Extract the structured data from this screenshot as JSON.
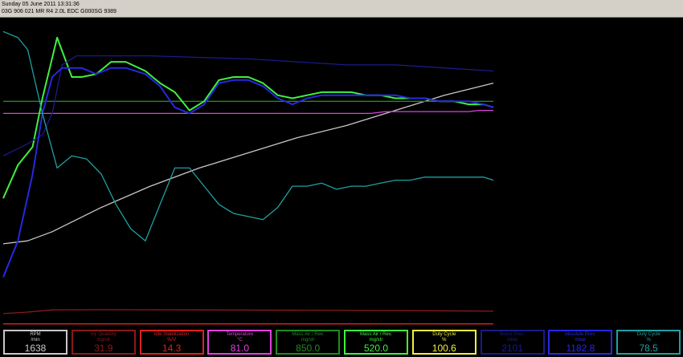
{
  "header": {
    "date_line": "Sunday 05 June 2011 13:31:36",
    "ecu_line": "03G 906 021 MR  R4 2.0L EDC G000SG  9389"
  },
  "panels": [
    {
      "name": "RPM",
      "unit": "/min",
      "value": "1638",
      "color": "#c8c8c8",
      "border": "#c8c8c8",
      "text_color": "#c8c8c8"
    },
    {
      "name": "Inj. Quantity",
      "unit": "mg/str",
      "value": "31.9",
      "color": "#8b1a1a",
      "border": "#8b1a1a",
      "text_color": "#8b1a1a"
    },
    {
      "name": "Idle Stabilization",
      "unit": "%/V",
      "value": "14.3",
      "color": "#e02020",
      "border": "#e02020",
      "text_color": "#e02020"
    },
    {
      "name": "Temperature",
      "unit": "°C",
      "value": "81.0",
      "color": "#e040e0",
      "border": "#e040e0",
      "text_color": "#e040e0"
    },
    {
      "name": "Mass Air / Rev.",
      "unit": "mg/str",
      "value": "850.0",
      "color": "#1e8c1e",
      "border": "#1e8c1e",
      "text_color": "#1e8c1e"
    },
    {
      "name": "Mass Air / Rev.",
      "unit": "mg/str",
      "value": "520.0",
      "color": "#40f040",
      "border": "#40f040",
      "text_color": "#40f040"
    },
    {
      "name": "Duty Cycle",
      "unit": "%",
      "value": "100.6",
      "color": "#f0f040",
      "border": "#f0f040",
      "text_color": "#f0f040"
    },
    {
      "name": "Boost Pres.",
      "unit": "mbar",
      "value": "2101",
      "color": "#1a1a8b",
      "border": "#1a1a8b",
      "text_color": "#1a1a8b"
    },
    {
      "name": "Absolute Pres.",
      "unit": "mbar",
      "value": "1182.8",
      "color": "#2828e0",
      "border": "#2828e0",
      "text_color": "#2828e0"
    },
    {
      "name": "Duty Cycle",
      "unit": "%",
      "value": "78.5",
      "color": "#20a0a0",
      "border": "#20a0a0",
      "text_color": "#20a0a0"
    }
  ],
  "chart_data": {
    "type": "line",
    "grid": false,
    "x_range": [
      0,
      100
    ],
    "y_range": [
      0,
      100
    ],
    "series": [
      {
        "name": "RPM",
        "color": "#c8c8c8",
        "x": [
          0,
          5,
          10,
          20,
          30,
          40,
          50,
          60,
          70,
          80,
          90,
          100
        ],
        "y": [
          27,
          28,
          31,
          39,
          46,
          52,
          57,
          62,
          66,
          71,
          76,
          80
        ]
      },
      {
        "name": "Inj. Quantity",
        "color": "#8b1a1a",
        "x": [
          0,
          5,
          10,
          20,
          40,
          60,
          80,
          100
        ],
        "y": [
          4,
          4.5,
          5.2,
          5.3,
          5.2,
          5.1,
          5.0,
          4.8
        ]
      },
      {
        "name": "Idle Stabilization",
        "color": "#e02020",
        "x": [
          0,
          100
        ],
        "y": [
          0.6,
          0.6
        ]
      },
      {
        "name": "Temperature",
        "color": "#e040e0",
        "x": [
          0,
          50,
          75,
          78,
          95,
          97,
          100
        ],
        "y": [
          70,
          70,
          70,
          70.6,
          70.6,
          71,
          71
        ]
      },
      {
        "name": "Mass Air / Rev.",
        "color": "#1e8c1e",
        "x": [
          0,
          100
        ],
        "y": [
          74,
          74
        ]
      },
      {
        "name": "Mass Air / Rev.",
        "color": "#40f040",
        "x": [
          0,
          3,
          6,
          8,
          11,
          14,
          16,
          19,
          22,
          25,
          29,
          32,
          35,
          38,
          41,
          44,
          47,
          50,
          53,
          56,
          59,
          62,
          65,
          68,
          71,
          74,
          77,
          80,
          83,
          86,
          89,
          92,
          95,
          98,
          100
        ],
        "y": [
          42,
          53,
          59,
          75,
          95,
          82,
          82,
          83,
          87,
          87,
          84,
          80,
          77,
          71,
          74,
          81,
          82,
          82,
          80,
          76,
          75,
          76,
          77,
          77,
          77,
          76,
          76,
          75,
          75,
          75,
          74,
          74,
          73,
          73,
          72
        ]
      },
      {
        "name": "Boost Pres.",
        "color": "#1a1a8b",
        "x": [
          0,
          5,
          8,
          10,
          12,
          15,
          30,
          50,
          60,
          70,
          80,
          90,
          100
        ],
        "y": [
          56,
          60,
          63,
          70,
          86,
          89,
          89,
          88,
          87,
          86,
          86,
          85,
          84
        ]
      },
      {
        "name": "Absolute Pres.",
        "color": "#2828e0",
        "x": [
          0,
          3,
          6,
          8,
          10,
          12,
          16,
          19,
          22,
          25,
          29,
          32,
          35,
          38,
          41,
          44,
          47,
          50,
          53,
          56,
          59,
          62,
          65,
          68,
          71,
          74,
          77,
          80,
          83,
          86,
          89,
          92,
          95,
          98,
          100
        ],
        "y": [
          16,
          28,
          50,
          70,
          82,
          85,
          85,
          83,
          85,
          85,
          83,
          79,
          72,
          70,
          73,
          80,
          81,
          81,
          79,
          75,
          73,
          75,
          76,
          76,
          76,
          76,
          76,
          76,
          75,
          75,
          74,
          74,
          74,
          73,
          72
        ]
      },
      {
        "name": "Duty Cycle",
        "color": "#20a0a0",
        "x": [
          0,
          3,
          5,
          8,
          11,
          14,
          17,
          20,
          23,
          26,
          29,
          32,
          35,
          38,
          41,
          44,
          47,
          50,
          53,
          56,
          59,
          62,
          65,
          68,
          71,
          74,
          77,
          80,
          83,
          86,
          89,
          92,
          95,
          98,
          100
        ],
        "y": [
          97,
          95,
          91,
          70,
          52,
          56,
          55,
          50,
          40,
          32,
          28,
          40,
          52,
          52,
          46,
          40,
          37,
          36,
          35,
          39,
          46,
          46,
          47,
          45,
          46,
          46,
          47,
          48,
          48,
          49,
          49,
          49,
          49,
          49,
          48
        ]
      }
    ]
  }
}
